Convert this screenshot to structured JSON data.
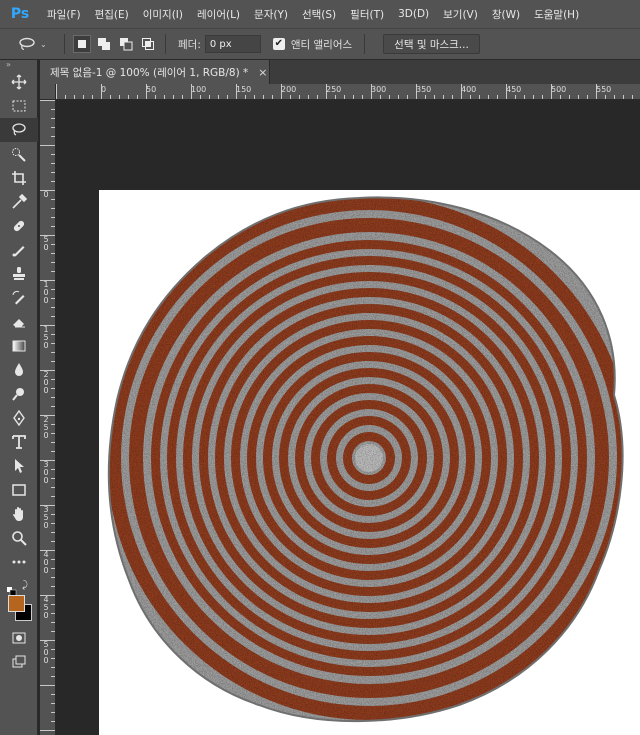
{
  "app": {
    "logo": "Ps"
  },
  "menu": [
    "파일(F)",
    "편집(E)",
    "이미지(I)",
    "레이어(L)",
    "문자(Y)",
    "선택(S)",
    "필터(T)",
    "3D(D)",
    "보기(V)",
    "창(W)",
    "도움말(H)"
  ],
  "options": {
    "tool_icon": "lasso-icon",
    "feather_label": "페더:",
    "feather_value": "0 px",
    "antialias_label": "앤티 앨리어스",
    "antialias_checked": true,
    "mask_button": "선택 및 마스크..."
  },
  "document": {
    "tab_title": "제목 없음-1 @ 100% (레이어 1, RGB/8) *",
    "close_label": "×"
  },
  "ruler": {
    "h_labels": [
      "0",
      "50",
      "100",
      "150",
      "200",
      "250",
      "300",
      "350",
      "400",
      "450",
      "500",
      "550"
    ],
    "v_labels": [
      "0",
      "5 0",
      "1 0 0",
      "1 5 0",
      "2 0 0",
      "2 5 0",
      "3 0 0",
      "3 5 0",
      "4 0 0",
      "4 5 0",
      "5 0 0"
    ]
  },
  "tools": [
    "move-icon",
    "marquee-icon",
    "lasso-icon",
    "quick-select-icon",
    "crop-icon",
    "eyedropper-icon",
    "healing-brush-icon",
    "brush-icon",
    "clone-stamp-icon",
    "history-brush-icon",
    "eraser-icon",
    "gradient-icon",
    "blur-icon",
    "dodge-icon",
    "pen-icon",
    "type-icon",
    "path-select-icon",
    "rectangle-icon",
    "hand-icon",
    "zoom-icon",
    "more-tools-icon"
  ],
  "colors": {
    "foreground": "#b5651d",
    "background": "#000000",
    "ring_brown": "#8b3a1f",
    "ring_gray": "#9a9a9a"
  }
}
